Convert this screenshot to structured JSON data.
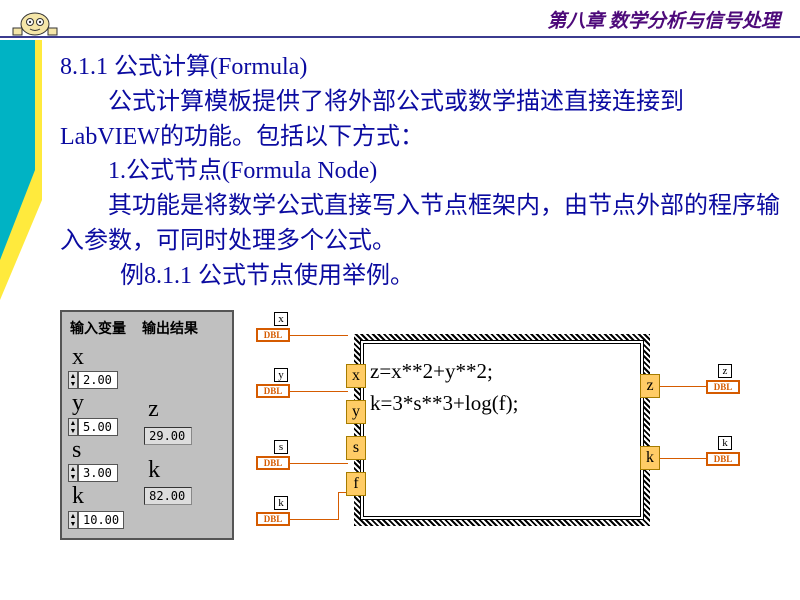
{
  "header": {
    "chapter_title": "第八章  数学分析与信号处理"
  },
  "text": {
    "h1": "8.1.1 公式计算(Formula)",
    "p1": "公式计算模板提供了将外部公式或数学描述直接连接到LabVIEW的功能。包括以下方式：",
    "li1": "1.公式节点(Formula Node)",
    "p2": "其功能是将数学公式直接写入节点框架内，由节点外部的程序输入参数，可同时处理多个公式。",
    "p3": "例8.1.1 公式节点使用举例。"
  },
  "front_panel": {
    "head_in": "输入变量",
    "head_out": "输出结果",
    "vars": {
      "x": {
        "label": "x",
        "value": "2.00"
      },
      "y": {
        "label": "y",
        "value": "5.00"
      },
      "s": {
        "label": "s",
        "value": "3.00"
      },
      "k_in": {
        "label": "k",
        "value": "10.00"
      }
    },
    "outs": {
      "z": {
        "label": "z",
        "value": "29.00"
      },
      "k": {
        "label": "k",
        "value": "82.00"
      }
    }
  },
  "block_diagram": {
    "dbl": "DBL",
    "inputs": [
      "x",
      "y",
      "s",
      "k"
    ],
    "outputs": [
      "z",
      "k"
    ],
    "tabs_in": [
      "x",
      "y",
      "s",
      "f"
    ],
    "tabs_out": [
      "z",
      "k"
    ],
    "formula_line1": "z=x**2+y**2;",
    "formula_line2": "k=3*s**3+log(f);"
  }
}
